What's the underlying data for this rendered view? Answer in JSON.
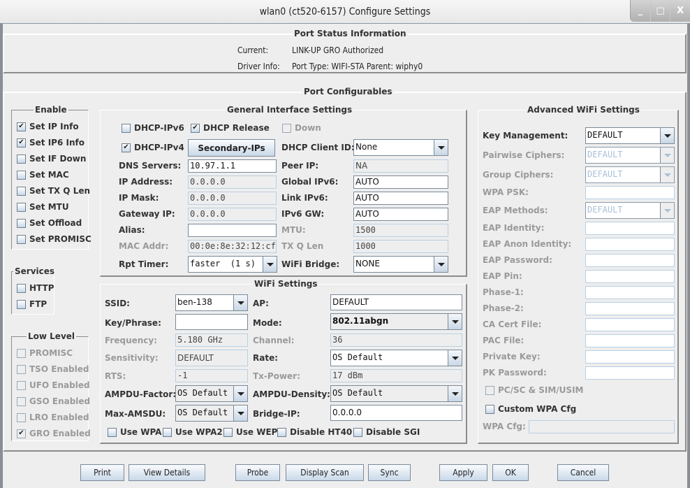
{
  "window": {
    "title": "wlan0  (ct520-6157) Configure Settings",
    "controls": {
      "minimize": "_",
      "maximize": "□",
      "close": "X"
    }
  },
  "port_status": {
    "legend": "Port Status Information",
    "current_label": "Current:",
    "current_value": "LINK-UP GRO  Authorized",
    "driver_label": "Driver Info:",
    "driver_value": "Port Type: WIFI-STA   Parent: wiphy0"
  },
  "configurables": {
    "legend": "Port Configurables"
  },
  "enable": {
    "legend": "Enable",
    "items": [
      {
        "label": "Set IP Info",
        "checked": true
      },
      {
        "label": "Set IP6 Info",
        "checked": true
      },
      {
        "label": "Set IF Down",
        "checked": false
      },
      {
        "label": "Set MAC",
        "checked": false
      },
      {
        "label": "Set TX Q Len",
        "checked": false
      },
      {
        "label": "Set MTU",
        "checked": false
      },
      {
        "label": "Set Offload",
        "checked": false
      },
      {
        "label": "Set PROMISC",
        "checked": false
      }
    ]
  },
  "services": {
    "legend": "Services",
    "items": [
      {
        "label": "HTTP",
        "checked": false
      },
      {
        "label": "FTP",
        "checked": false
      }
    ]
  },
  "low_level": {
    "legend": "Low Level",
    "items": [
      {
        "label": "PROMISC",
        "checked": false
      },
      {
        "label": "TSO Enabled",
        "checked": false
      },
      {
        "label": "UFO Enabled",
        "checked": false
      },
      {
        "label": "GSO Enabled",
        "checked": false
      },
      {
        "label": "LRO Enabled",
        "checked": false
      },
      {
        "label": "GRO Enabled",
        "checked": true
      }
    ]
  },
  "general": {
    "legend": "General Interface Settings",
    "dhcp_ipv6": {
      "label": "DHCP-IPv6",
      "checked": false
    },
    "dhcp_release": {
      "label": "DHCP Release",
      "checked": true
    },
    "down": {
      "label": "Down",
      "checked": false
    },
    "dhcp_ipv4": {
      "label": "DHCP-IPv4",
      "checked": true
    },
    "secondary_ips": "Secondary-IPs",
    "dhcp_client_id": {
      "label": "DHCP Client ID:",
      "value": "None"
    },
    "dns_servers": {
      "label": "DNS Servers:",
      "value": "10.97.1.1"
    },
    "ip_address": {
      "label": "IP Address:",
      "value": "0.0.0.0"
    },
    "ip_mask": {
      "label": "IP Mask:",
      "value": "0.0.0.0"
    },
    "gateway_ip": {
      "label": "Gateway IP:",
      "value": "0.0.0.0"
    },
    "alias": {
      "label": "Alias:",
      "value": ""
    },
    "mac_addr": {
      "label": "MAC Addr:",
      "value": "00:0e:8e:32:12:cf"
    },
    "rpt_timer": {
      "label": "Rpt Timer:",
      "value": "faster  (1 s)"
    },
    "peer_ip": {
      "label": "Peer IP:",
      "value": "NA"
    },
    "global_ipv6": {
      "label": "Global IPv6:",
      "value": "AUTO"
    },
    "link_ipv6": {
      "label": "Link IPv6:",
      "value": "AUTO"
    },
    "ipv6_gw": {
      "label": "IPv6 GW:",
      "value": "AUTO"
    },
    "mtu": {
      "label": "MTU:",
      "value": "1500"
    },
    "tx_q_len": {
      "label": "TX Q Len",
      "value": "1000"
    },
    "wifi_bridge": {
      "label": "WiFi Bridge:",
      "value": "NONE"
    }
  },
  "wifi": {
    "legend": "WiFi Settings",
    "ssid": {
      "label": "SSID:",
      "value": "ben-138"
    },
    "key_phrase": {
      "label": "Key/Phrase:",
      "value": ""
    },
    "frequency": {
      "label": "Frequency:",
      "value": "5.180 GHz"
    },
    "sensitivity": {
      "label": "Sensitivity:",
      "value": "DEFAULT"
    },
    "rts": {
      "label": "RTS:",
      "value": "-1"
    },
    "ampdu_factor": {
      "label": "AMPDU-Factor:",
      "value": "OS Default"
    },
    "max_amsdu": {
      "label": "Max-AMSDU:",
      "value": "OS Default"
    },
    "ap": {
      "label": "AP:",
      "value": "DEFAULT"
    },
    "mode": {
      "label": "Mode:",
      "value": "802.11abgn"
    },
    "channel": {
      "label": "Channel:",
      "value": "36"
    },
    "rate": {
      "label": "Rate:",
      "value": "OS Default"
    },
    "tx_power": {
      "label": "Tx-Power:",
      "value": "17 dBm"
    },
    "ampdu_density": {
      "label": "AMPDU-Density:",
      "value": "OS Default"
    },
    "bridge_ip": {
      "label": "Bridge-IP:",
      "value": "0.0.0.0"
    },
    "use_wpa": {
      "label": "Use WPA",
      "checked": false
    },
    "use_wpa2": {
      "label": "Use WPA2",
      "checked": false
    },
    "use_wep": {
      "label": "Use WEP",
      "checked": false
    },
    "disable_ht40": {
      "label": "Disable HT40",
      "checked": false
    },
    "disable_sgi": {
      "label": "Disable SGI",
      "checked": false
    }
  },
  "advanced": {
    "legend": "Advanced WiFi Settings",
    "key_management": {
      "label": "Key Management:",
      "value": "DEFAULT"
    },
    "pairwise_ciphers": {
      "label": "Pairwise Ciphers:",
      "value": "DEFAULT"
    },
    "group_ciphers": {
      "label": "Group Ciphers:",
      "value": "DEFAULT"
    },
    "wpa_psk": {
      "label": "WPA PSK:",
      "value": ""
    },
    "eap_methods": {
      "label": "EAP Methods:",
      "value": "DEFAULT"
    },
    "eap_identity": {
      "label": "EAP Identity:",
      "value": ""
    },
    "eap_anon_identity": {
      "label": "EAP Anon Identity:",
      "value": ""
    },
    "eap_password": {
      "label": "EAP Password:",
      "value": ""
    },
    "eap_pin": {
      "label": "EAP Pin:",
      "value": ""
    },
    "phase1": {
      "label": "Phase-1:",
      "value": ""
    },
    "phase2": {
      "label": "Phase-2:",
      "value": ""
    },
    "ca_cert_file": {
      "label": "CA Cert File:",
      "value": ""
    },
    "pac_file": {
      "label": "PAC File:",
      "value": ""
    },
    "private_key": {
      "label": "Private Key:",
      "value": ""
    },
    "pk_password": {
      "label": "PK Password:",
      "value": ""
    },
    "pcsc": {
      "label": "PC/SC & SIM/USIM",
      "checked": false
    },
    "custom_wpa_cfg": {
      "label": "Custom WPA Cfg",
      "checked": false
    },
    "wpa_cfg": {
      "label": "WPA Cfg:",
      "value": ""
    }
  },
  "buttons": {
    "print": "Print",
    "view_details": "View Details",
    "probe": "Probe",
    "display_scan": "Display Scan",
    "sync": "Sync",
    "apply": "Apply",
    "ok": "OK",
    "cancel": "Cancel"
  },
  "check_glyph": "✔"
}
